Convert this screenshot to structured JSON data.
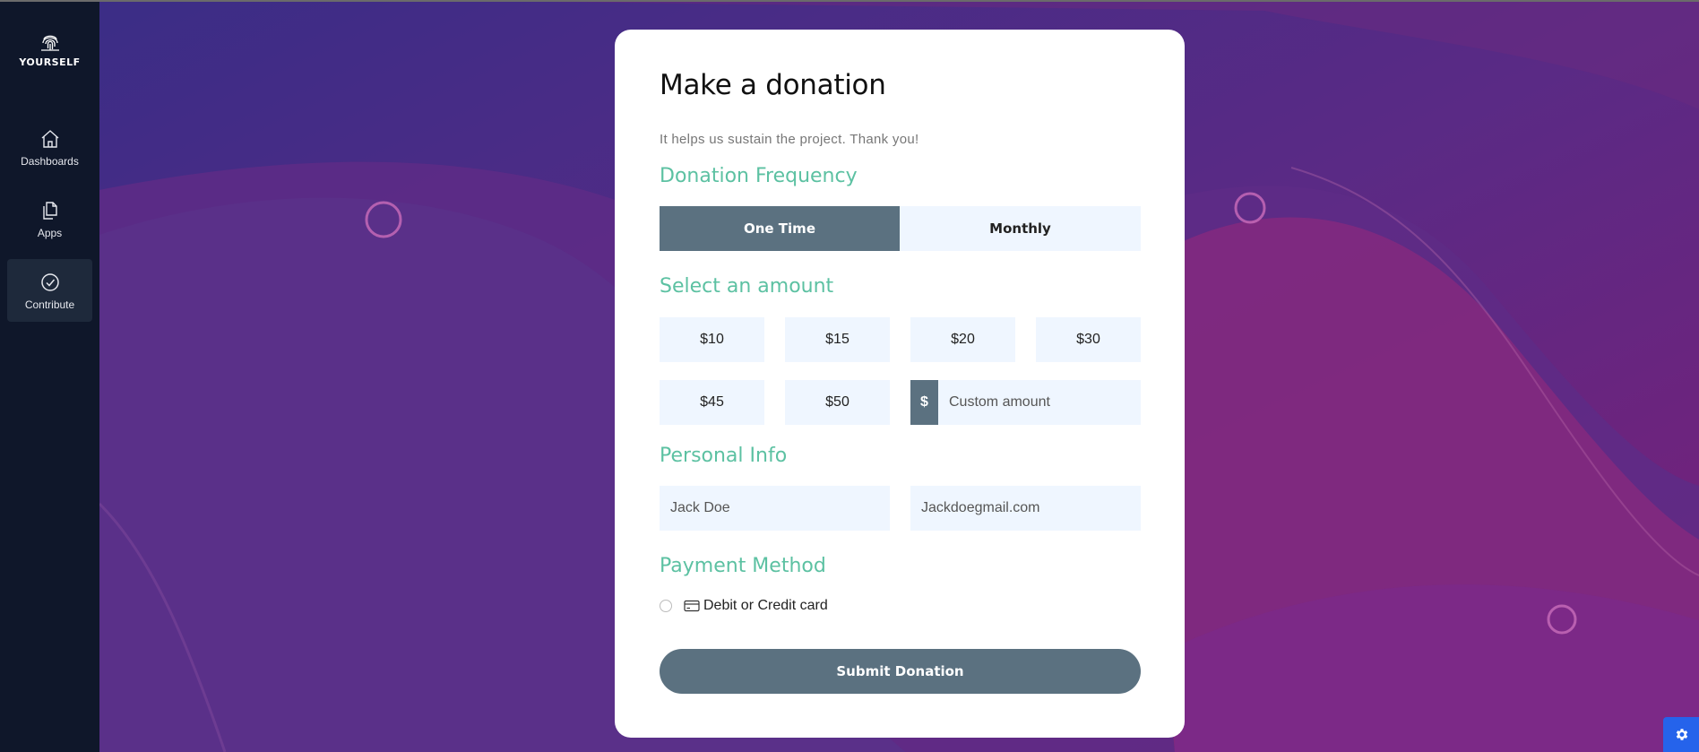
{
  "sidebar": {
    "logo_text": "YOURSELF",
    "items": [
      {
        "label": "Dashboards",
        "icon": "home-icon"
      },
      {
        "label": "Apps",
        "icon": "documents-icon"
      },
      {
        "label": "Contribute",
        "icon": "check-circle-icon",
        "active": true
      }
    ]
  },
  "donation": {
    "title": "Make a donation",
    "subtitle": "It helps us sustain the project. Thank you!",
    "frequency": {
      "heading": "Donation Frequency",
      "options": [
        "One Time",
        "Monthly"
      ],
      "selected": "One Time"
    },
    "amount": {
      "heading": "Select an amount",
      "options": [
        "$10",
        "$15",
        "$20",
        "$30",
        "$45",
        "$50"
      ],
      "currency_symbol": "$",
      "custom_placeholder": "Custom amount"
    },
    "personal": {
      "heading": "Personal Info",
      "name_placeholder": "Jack Doe",
      "email_placeholder": "Jackdoegmail.com"
    },
    "payment": {
      "heading": "Payment Method",
      "options": [
        {
          "label": "Debit or Credit card",
          "icon": "credit-card-icon",
          "selected": false
        }
      ]
    },
    "submit_label": "Submit Donation"
  },
  "colors": {
    "accent": "#5cc1a2",
    "primary": "#5b7180",
    "sidebar": "#0f172a",
    "field_bg": "#eff6ff",
    "settings_button": "#2563eb"
  }
}
